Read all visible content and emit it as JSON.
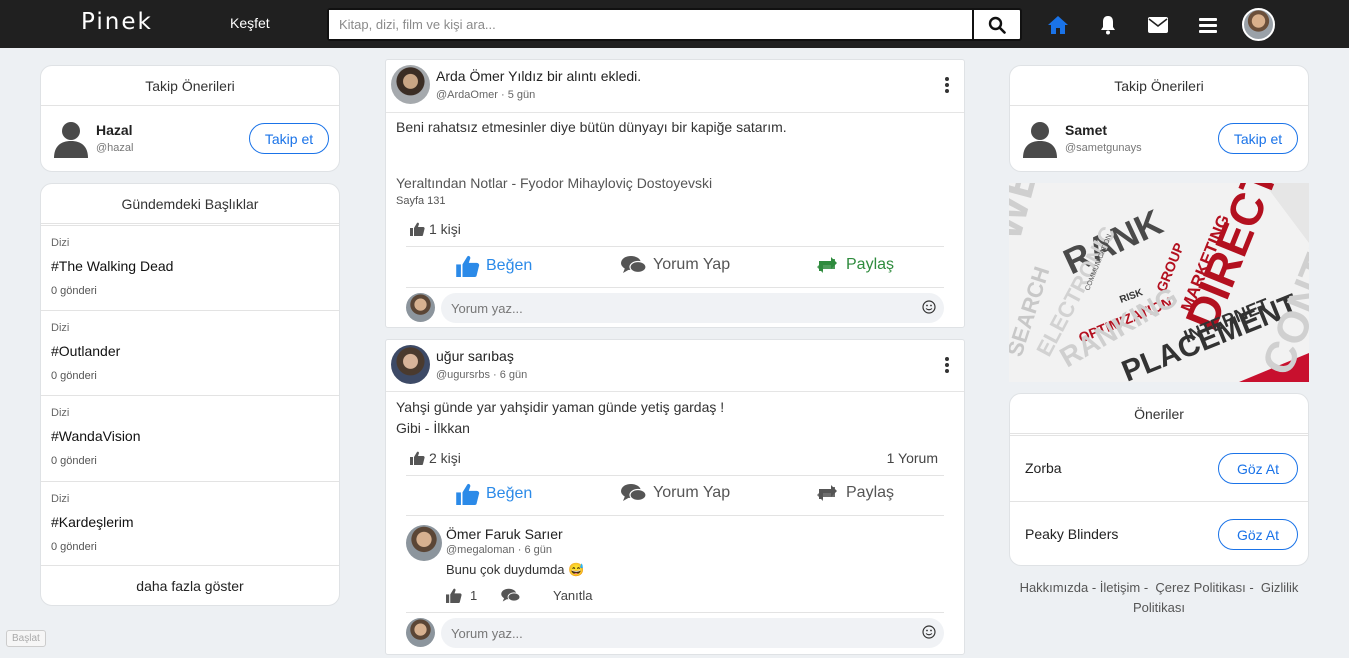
{
  "app": {
    "logo": "Pinek",
    "explore": "Keşfet"
  },
  "search": {
    "placeholder": "Kitap, dizi, film ve kişi ara..."
  },
  "left": {
    "follow_title": "Takip Önerileri",
    "follow": {
      "name": "Hazal",
      "handle": "@hazal",
      "button": "Takip et"
    },
    "trending_title": "Gündemdeki Başlıklar",
    "trends": [
      {
        "category": "Dizi",
        "tag": "#The Walking Dead",
        "count": "0 gönderi"
      },
      {
        "category": "Dizi",
        "tag": "#Outlander",
        "count": "0 gönderi"
      },
      {
        "category": "Dizi",
        "tag": "#WandaVision",
        "count": "0 gönderi"
      },
      {
        "category": "Dizi",
        "tag": "#Kardeşlerim",
        "count": "0 gönderi"
      }
    ],
    "show_more": "daha fazla göster"
  },
  "posts": [
    {
      "author": "Arda Ömer Yıldız",
      "action": " bir alıntı ekledi.",
      "handle": "@ArdaOmer",
      "time": "5 gün",
      "text": "Beni rahatsız etmesinler diye bütün dünyayı bir kapiğe satarım.",
      "source": "Yeraltından Notlar - Fyodor Mihayloviç Dostoyevski",
      "page": "Sayfa 131",
      "likes": "1 kişi",
      "like_label": "Beğen",
      "comment_label": "Yorum Yap",
      "share_label": "Paylaş",
      "comment_placeholder": "Yorum yaz..."
    },
    {
      "author": "uğur sarıbaş",
      "handle": "@ugursrbs",
      "time": "6 gün",
      "text": "Yahşi günde yar yahşidir yaman günde yetiş gardaş !",
      "text2": "Gibi - İlkkan",
      "likes": "2 kişi",
      "comments_count": "1 Yorum",
      "like_label": "Beğen",
      "comment_label": "Yorum Yap",
      "share_label": "Paylaş",
      "reply": {
        "author": "Ömer Faruk Sarıer",
        "handle": "@megaloman",
        "time": "6 gün",
        "text": "Bunu çok duydumda 😅",
        "likes": "1",
        "reply_label": "Yanıtla"
      },
      "comment_placeholder": "Yorum yaz..."
    }
  ],
  "right": {
    "follow_title": "Takip Önerileri",
    "follow": {
      "name": "Samet",
      "handle": "@sametgunays",
      "button": "Takip et"
    },
    "ad_words": [
      "WEB",
      "RANK",
      "DIRECT",
      "MARKETING",
      "GROUP",
      "RISK",
      "OPTIMIZATION",
      "INTERNET",
      "PLACEMENT",
      "RANKING",
      "ELECTRONIC",
      "SEARCH",
      "CONTENT",
      "COMMUNICATION"
    ],
    "suggestions_title": "Öneriler",
    "suggestions": [
      {
        "name": "Zorba",
        "button": "Göz At"
      },
      {
        "name": "Peaky Blinders",
        "button": "Göz At"
      }
    ],
    "footer": [
      "Hakkımızda",
      "İletişim",
      "Çerez Politikası",
      "Gizlilik Politikası"
    ]
  },
  "start_tag": "Başlat",
  "colors": {
    "accent": "#1a73e8",
    "share_active": "#2e8b3d",
    "topbar": "#202020",
    "like_active": "#2b8ae8"
  }
}
